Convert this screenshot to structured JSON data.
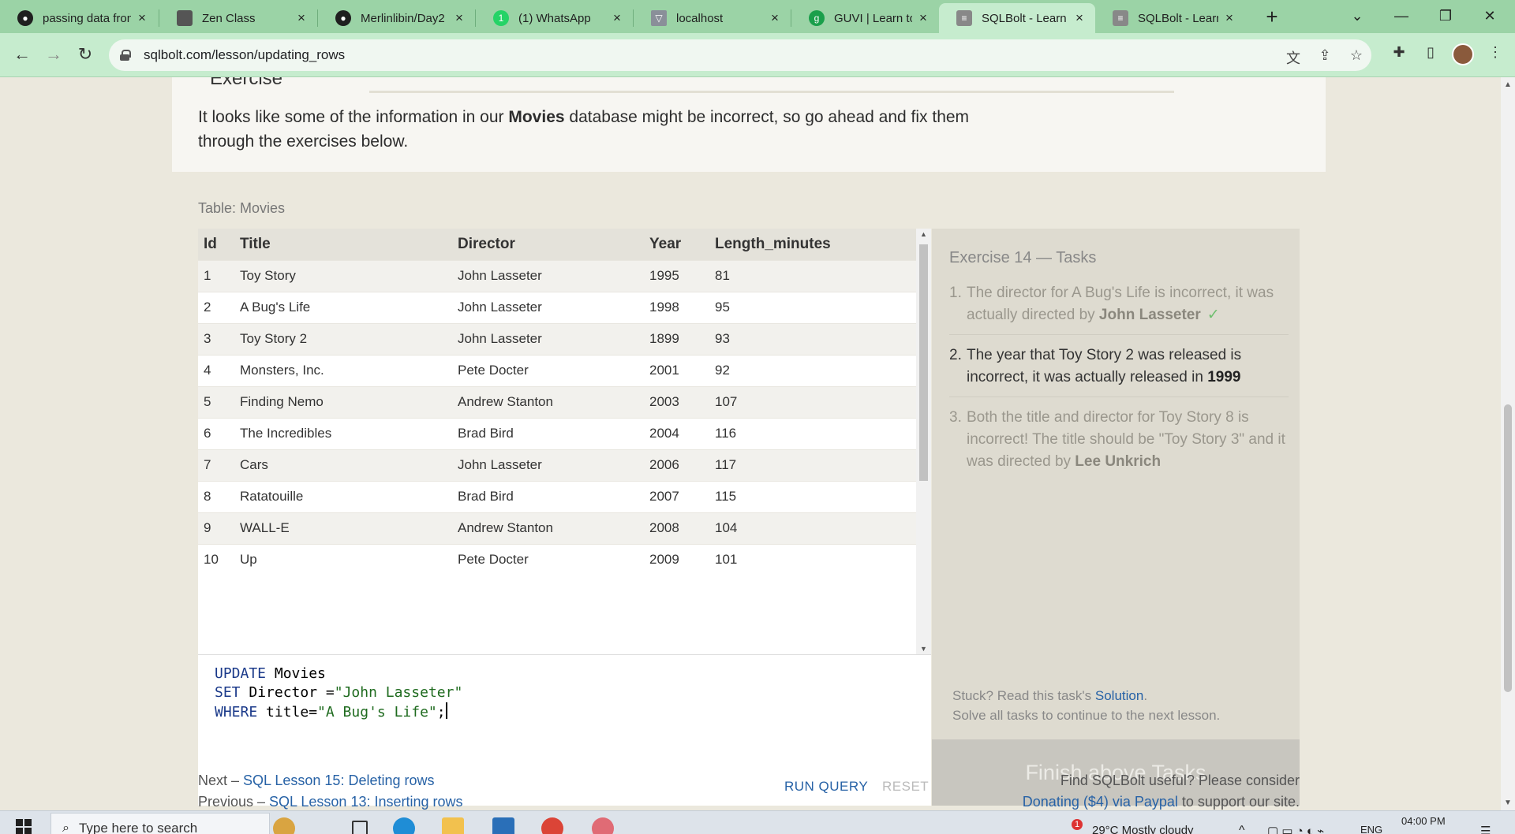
{
  "browser": {
    "tabs": [
      {
        "label": "passing data fron",
        "active": false
      },
      {
        "label": "Zen Class",
        "active": false
      },
      {
        "label": "Merlinlibin/Day2",
        "active": false
      },
      {
        "label": "(1) WhatsApp",
        "active": false
      },
      {
        "label": "localhost",
        "active": false
      },
      {
        "label": "GUVI | Learn to c",
        "active": false
      },
      {
        "label": "SQLBolt - Learn S",
        "active": true
      },
      {
        "label": "SQLBolt - Learn S",
        "active": false
      }
    ],
    "url": "sqlbolt.com/lesson/updating_rows"
  },
  "lesson": {
    "exercise_header": "Exercise",
    "intro_before": "It looks like some of the information in our ",
    "intro_bold": "Movies",
    "intro_after": " database might be incorrect, so go ahead and fix them through the exercises below."
  },
  "table": {
    "label": "Table: Movies",
    "columns": [
      "Id",
      "Title",
      "Director",
      "Year",
      "Length_minutes"
    ],
    "rows": [
      [
        "1",
        "Toy Story",
        "John Lasseter",
        "1995",
        "81"
      ],
      [
        "2",
        "A Bug's Life",
        "John Lasseter",
        "1998",
        "95"
      ],
      [
        "3",
        "Toy Story 2",
        "John Lasseter",
        "1899",
        "93"
      ],
      [
        "4",
        "Monsters, Inc.",
        "Pete Docter",
        "2001",
        "92"
      ],
      [
        "5",
        "Finding Nemo",
        "Andrew Stanton",
        "2003",
        "107"
      ],
      [
        "6",
        "The Incredibles",
        "Brad Bird",
        "2004",
        "116"
      ],
      [
        "7",
        "Cars",
        "John Lasseter",
        "2006",
        "117"
      ],
      [
        "8",
        "Ratatouille",
        "Brad Bird",
        "2007",
        "115"
      ],
      [
        "9",
        "WALL-E",
        "Andrew Stanton",
        "2008",
        "104"
      ],
      [
        "10",
        "Up",
        "Pete Docter",
        "2009",
        "101"
      ]
    ]
  },
  "editor": {
    "line1_kw": "UPDATE",
    "line1_rest": " Movies",
    "line2_kw": "SET",
    "line2_rest": " Director =",
    "line2_str": "\"John Lasseter\"",
    "line3_kw": "WHERE",
    "line3_rest": " title=",
    "line3_str": "\"A Bug's Life\"",
    "line3_end": ";",
    "run_label": "RUN QUERY",
    "reset_label": "RESET"
  },
  "tasks": {
    "title": "Exercise 14 — Tasks",
    "items": [
      {
        "num": "1.",
        "text": "The director for A Bug's Life is incorrect, it was actually directed by ",
        "bold": "John Lasseter",
        "suffix": "",
        "check": "✓",
        "state": "done"
      },
      {
        "num": "2.",
        "text": "The year that Toy Story 2 was released is incorrect, it was actually released in ",
        "bold": "1999",
        "suffix": "",
        "state": "current"
      },
      {
        "num": "3.",
        "text": "Both the title and director for Toy Story 8 is incorrect! The title should be \"Toy Story 3\" and it was directed by ",
        "bold": "Lee Unkrich",
        "suffix": "",
        "state": "future"
      }
    ],
    "stuck_prefix": "Stuck? Read this task's ",
    "stuck_link": "Solution",
    "stuck_suffix": ".",
    "solve_note": "Solve all tasks to continue to the next lesson.",
    "finish_label": "Finish above Tasks"
  },
  "footer_nav": {
    "next_prefix": "Next – ",
    "next_link": "SQL Lesson 15: Deleting rows",
    "prev_prefix": "Previous – ",
    "prev_link": "SQL Lesson 13: Inserting rows",
    "donate_line1": "Find SQLBolt useful? Please consider",
    "donate_link": "Donating ($4) via Paypal",
    "donate_suffix": " to support our site."
  },
  "taskbar": {
    "search_placeholder": "Type here to search",
    "weather": "29°C  Mostly cloudy",
    "language": "ENG",
    "time": "04:00 PM",
    "notification_badge": "1"
  },
  "colors": {
    "tabbar": "#9bd3a6",
    "link": "#2762a6",
    "page_bg": "#ebe8dd"
  },
  "icons": {
    "back": "←",
    "forward": "→",
    "reload": "↻",
    "close": "×",
    "new_tab": "+",
    "star": "☆",
    "chevron_down": "⌄",
    "minimize": "—",
    "restore": "❐",
    "win_close": "✕"
  }
}
